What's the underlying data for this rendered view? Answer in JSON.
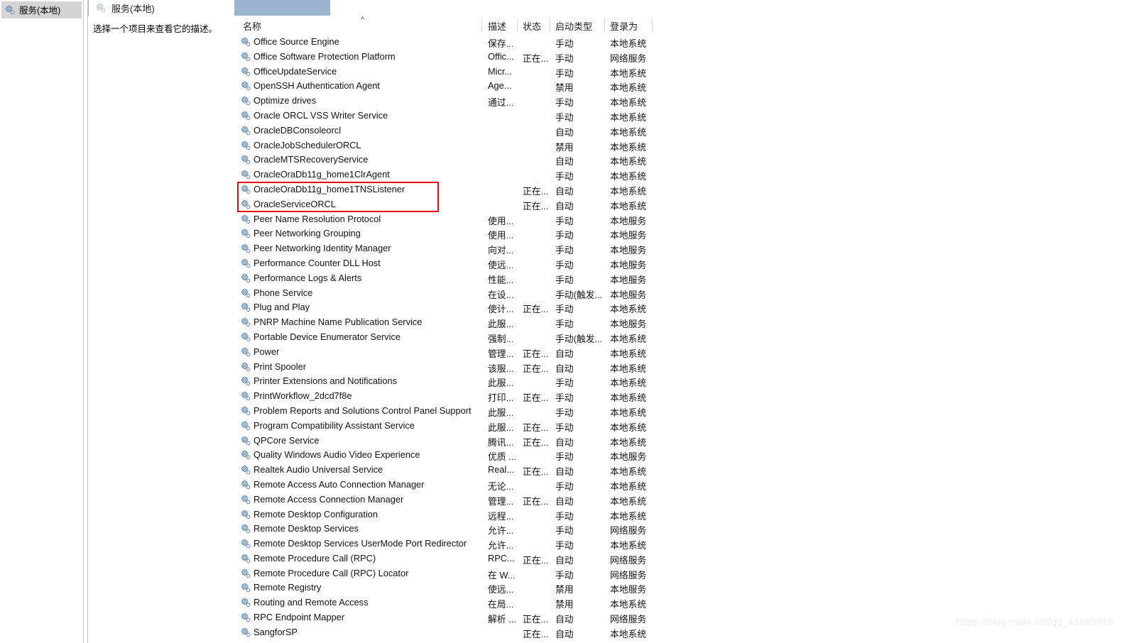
{
  "window": {
    "tree_node_label": "服务(本地)",
    "tree_node_icon": "services-gear-icon"
  },
  "details": {
    "title": "服务(本地)",
    "title_icon": "services-gear-icon",
    "description_placeholder": "选择一个项目来查看它的描述。"
  },
  "columns": {
    "name": "名称",
    "description": "描述",
    "status": "状态",
    "startup_type": "启动类型",
    "log_on_as": "登录为",
    "sort_indicator": "^"
  },
  "annotation": {
    "color": "#e8070a",
    "highlighted_rows": [
      "OracleOraDb11g_home1TNSListener",
      "OracleServiceORCL"
    ]
  },
  "watermark": "https://blog.csdn.net/qq_41885819",
  "services": [
    {
      "name": "Office  Source Engine",
      "desc": "保存...",
      "status": "",
      "startup": "手动",
      "logon": "本地系统"
    },
    {
      "name": "Office Software Protection Platform",
      "desc": "Offic...",
      "status": "正在...",
      "startup": "手动",
      "logon": "网络服务"
    },
    {
      "name": "OfficeUpdateService",
      "desc": "Micr...",
      "status": "",
      "startup": "手动",
      "logon": "本地系统"
    },
    {
      "name": "OpenSSH Authentication Agent",
      "desc": "Age...",
      "status": "",
      "startup": "禁用",
      "logon": "本地系统"
    },
    {
      "name": "Optimize drives",
      "desc": "通过...",
      "status": "",
      "startup": "手动",
      "logon": "本地系统"
    },
    {
      "name": "Oracle ORCL VSS Writer Service",
      "desc": "",
      "status": "",
      "startup": "手动",
      "logon": "本地系统"
    },
    {
      "name": "OracleDBConsoleorcl",
      "desc": "",
      "status": "",
      "startup": "自动",
      "logon": "本地系统"
    },
    {
      "name": "OracleJobSchedulerORCL",
      "desc": "",
      "status": "",
      "startup": "禁用",
      "logon": "本地系统"
    },
    {
      "name": "OracleMTSRecoveryService",
      "desc": "",
      "status": "",
      "startup": "自动",
      "logon": "本地系统"
    },
    {
      "name": "OracleOraDb11g_home1ClrAgent",
      "desc": "",
      "status": "",
      "startup": "手动",
      "logon": "本地系统"
    },
    {
      "name": "OracleOraDb11g_home1TNSListener",
      "desc": "",
      "status": "正在...",
      "startup": "自动",
      "logon": "本地系统"
    },
    {
      "name": "OracleServiceORCL",
      "desc": "",
      "status": "正在...",
      "startup": "自动",
      "logon": "本地系统"
    },
    {
      "name": "Peer Name Resolution Protocol",
      "desc": "使用...",
      "status": "",
      "startup": "手动",
      "logon": "本地服务"
    },
    {
      "name": "Peer Networking Grouping",
      "desc": "使用...",
      "status": "",
      "startup": "手动",
      "logon": "本地服务"
    },
    {
      "name": "Peer Networking Identity Manager",
      "desc": "向对...",
      "status": "",
      "startup": "手动",
      "logon": "本地服务"
    },
    {
      "name": "Performance Counter DLL Host",
      "desc": "使远...",
      "status": "",
      "startup": "手动",
      "logon": "本地服务"
    },
    {
      "name": "Performance Logs & Alerts",
      "desc": "性能...",
      "status": "",
      "startup": "手动",
      "logon": "本地服务"
    },
    {
      "name": "Phone Service",
      "desc": "在设...",
      "status": "",
      "startup": "手动(触发...",
      "logon": "本地服务"
    },
    {
      "name": "Plug and Play",
      "desc": "使计...",
      "status": "正在...",
      "startup": "手动",
      "logon": "本地系统"
    },
    {
      "name": "PNRP Machine Name Publication Service",
      "desc": "此服...",
      "status": "",
      "startup": "手动",
      "logon": "本地服务"
    },
    {
      "name": "Portable Device Enumerator Service",
      "desc": "强制...",
      "status": "",
      "startup": "手动(触发...",
      "logon": "本地系统"
    },
    {
      "name": "Power",
      "desc": "管理...",
      "status": "正在...",
      "startup": "自动",
      "logon": "本地系统"
    },
    {
      "name": "Print Spooler",
      "desc": "该服...",
      "status": "正在...",
      "startup": "自动",
      "logon": "本地系统"
    },
    {
      "name": "Printer Extensions and Notifications",
      "desc": "此服...",
      "status": "",
      "startup": "手动",
      "logon": "本地系统"
    },
    {
      "name": "PrintWorkflow_2dcd7f8e",
      "desc": "打印...",
      "status": "正在...",
      "startup": "手动",
      "logon": "本地系统"
    },
    {
      "name": "Problem Reports and Solutions Control Panel Support",
      "desc": "此服...",
      "status": "",
      "startup": "手动",
      "logon": "本地系统"
    },
    {
      "name": "Program Compatibility Assistant Service",
      "desc": "此服...",
      "status": "正在...",
      "startup": "手动",
      "logon": "本地系统"
    },
    {
      "name": "QPCore Service",
      "desc": "腾讯...",
      "status": "正在...",
      "startup": "自动",
      "logon": "本地系统"
    },
    {
      "name": "Quality Windows Audio Video Experience",
      "desc": "优质 ...",
      "status": "",
      "startup": "手动",
      "logon": "本地服务"
    },
    {
      "name": "Realtek Audio Universal Service",
      "desc": "Real...",
      "status": "正在...",
      "startup": "自动",
      "logon": "本地系统"
    },
    {
      "name": "Remote Access Auto Connection Manager",
      "desc": "无论...",
      "status": "",
      "startup": "手动",
      "logon": "本地系统"
    },
    {
      "name": "Remote Access Connection Manager",
      "desc": "管理...",
      "status": "正在...",
      "startup": "自动",
      "logon": "本地系统"
    },
    {
      "name": "Remote Desktop Configuration",
      "desc": "远程...",
      "status": "",
      "startup": "手动",
      "logon": "本地系统"
    },
    {
      "name": "Remote Desktop Services",
      "desc": "允许...",
      "status": "",
      "startup": "手动",
      "logon": "网络服务"
    },
    {
      "name": "Remote Desktop Services UserMode Port Redirector",
      "desc": "允许...",
      "status": "",
      "startup": "手动",
      "logon": "本地系统"
    },
    {
      "name": "Remote Procedure Call (RPC)",
      "desc": "RPC...",
      "status": "正在...",
      "startup": "自动",
      "logon": "网络服务"
    },
    {
      "name": "Remote Procedure Call (RPC) Locator",
      "desc": "在 W...",
      "status": "",
      "startup": "手动",
      "logon": "网络服务"
    },
    {
      "name": "Remote Registry",
      "desc": "使远...",
      "status": "",
      "startup": "禁用",
      "logon": "本地服务"
    },
    {
      "name": "Routing and Remote Access",
      "desc": "在局...",
      "status": "",
      "startup": "禁用",
      "logon": "本地系统"
    },
    {
      "name": "RPC Endpoint Mapper",
      "desc": "解析 ...",
      "status": "正在...",
      "startup": "自动",
      "logon": "网络服务"
    },
    {
      "name": "SangforSP",
      "desc": "",
      "status": "正在...",
      "startup": "自动",
      "logon": "本地系统"
    }
  ]
}
